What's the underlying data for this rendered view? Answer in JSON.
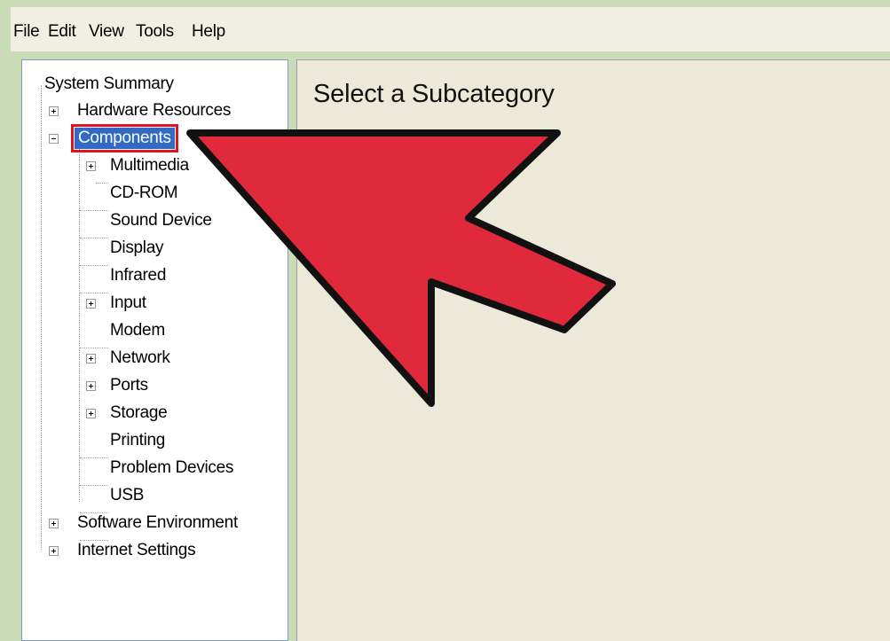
{
  "menu": [
    "File",
    "Edit",
    "View",
    "Tools",
    "Help"
  ],
  "tree": {
    "root": "System Summary",
    "hardware": "Hardware Resources",
    "components": "Components",
    "children": {
      "multimedia": "Multimedia",
      "cdrom": "CD-ROM",
      "sound": "Sound Device",
      "display": "Display",
      "infrared": "Infrared",
      "input": "Input",
      "modem": "Modem",
      "network": "Network",
      "ports": "Ports",
      "storage": "Storage",
      "printing": "Printing",
      "problem": "Problem Devices",
      "usb": "USB"
    },
    "software": "Software Environment",
    "internet": "Internet Settings"
  },
  "details": {
    "title": "Select a Subcategory"
  },
  "annotation": {
    "icon": "red-arrow-pointer",
    "color": "#e0293a",
    "target": "Components"
  },
  "colors": {
    "selection": "#316ac5",
    "highlight_border": "#e0141e"
  }
}
